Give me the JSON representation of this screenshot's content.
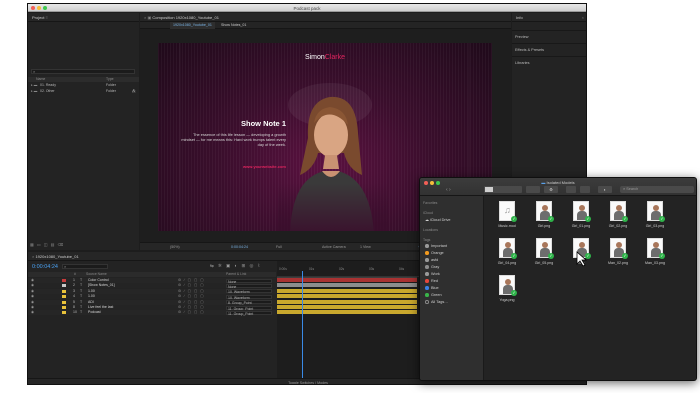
{
  "window": {
    "title": "Podcast pack"
  },
  "project_panel": {
    "title": "Project",
    "search_placeholder": "",
    "columns": [
      "Name",
      "Type"
    ],
    "items": [
      {
        "name": "01. Ready",
        "type": "Folder"
      },
      {
        "name": "02. Other",
        "type": "Folder"
      }
    ]
  },
  "composition_panel": {
    "header": "Composition 1920x1080_Youtube_01",
    "tabs": [
      "1920x1080_Youtube_01",
      "Show Notes_01"
    ],
    "bottom_bar": {
      "zoom": "(50%)",
      "time": "0:00:04:24",
      "resolution": "Full",
      "camera": "Active Camera",
      "view": "1 View",
      "offset": "+0.0"
    }
  },
  "composition": {
    "logo_first": "Simon",
    "logo_last": "Clarke",
    "title": "Show Note 1",
    "body": "The essence of this life lesson — developing a growth mindset — for me means this: Hard work trumps talent every day of the week.",
    "url": "www.yourwebsite.com"
  },
  "right_panel": {
    "title": "Info",
    "items": [
      "Preview",
      "Effects & Presets",
      "Libraries"
    ]
  },
  "timeline": {
    "tab": "1920x1080_Youtube_01",
    "time": "0:00:04:24",
    "layers": [
      {
        "num": "1",
        "name": "Color Control",
        "parent": "None",
        "color": "#c73b3b"
      },
      {
        "num": "2",
        "name": "[Show Notes_01]",
        "parent": "None",
        "color": "#c8c8c8"
      },
      {
        "num": "3",
        "name": "1.00",
        "parent": "10. Waveform",
        "color": "#e8c23a"
      },
      {
        "num": "4",
        "name": "1.00",
        "parent": "10. Waveform",
        "color": "#e8c23a"
      },
      {
        "num": "5",
        "name": "ADI",
        "parent": "8. Group_Point",
        "color": "#e8c23a"
      },
      {
        "num": "8",
        "name": "Live feel the last",
        "parent": "11. Group_Point",
        "color": "#e8c23a"
      },
      {
        "num": "10",
        "name": "Podcast",
        "parent": "11. Group_Point",
        "color": "#e8c23a"
      }
    ],
    "ruler": [
      "0:00s",
      "01s",
      "02s",
      "03s",
      "04s",
      "05s",
      "06s",
      "07s",
      "08s",
      "09s"
    ],
    "footer": "Toggle Switches / Modes"
  },
  "finder": {
    "title": "Isolated Models",
    "search_placeholder": "Search",
    "sidebar": {
      "favorites_label": "Favorites",
      "icloud_label": "iCloud",
      "icloud_drive": "iCloud Drive",
      "locations_label": "Locations",
      "tags_label": "Tags",
      "tags": [
        {
          "name": "Important",
          "color": "#9a9a9a"
        },
        {
          "name": "Orange",
          "color": "#f39a1e"
        },
        {
          "name": "asfd",
          "color": "#9a9a9a"
        },
        {
          "name": "Gray",
          "color": "#8e8e8e"
        },
        {
          "name": "Work",
          "color": "#9a9a9a"
        },
        {
          "name": "Red",
          "color": "#e5473b"
        },
        {
          "name": "Blue",
          "color": "#3b82e5"
        },
        {
          "name": "Green",
          "color": "#3ab54a"
        },
        {
          "name": "All Tags…",
          "color": ""
        }
      ]
    },
    "files": [
      {
        "name": "Music.mod"
      },
      {
        "name": "Girl.png"
      },
      {
        "name": "Girl_01.png"
      },
      {
        "name": "Girl_02.png"
      },
      {
        "name": "Girl_03.png"
      },
      {
        "name": "Girl_04.png"
      },
      {
        "name": "Girl_05.png"
      },
      {
        "name": "Man"
      },
      {
        "name": "Man_02.png"
      },
      {
        "name": "Man_03.png"
      },
      {
        "name": "Yoga.png"
      }
    ]
  }
}
